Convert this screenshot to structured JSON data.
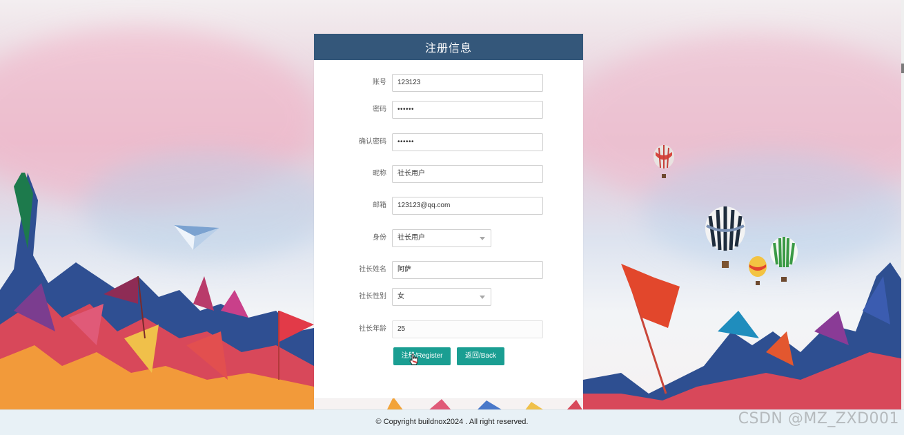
{
  "form": {
    "title": "注册信息",
    "fields": {
      "account": {
        "label": "账号",
        "value": "123123"
      },
      "password": {
        "label": "密码",
        "value": "••••••"
      },
      "confirm_password": {
        "label": "确认密码",
        "value": "••••••"
      },
      "nickname": {
        "label": "昵称",
        "value": "社长用户"
      },
      "email": {
        "label": "邮箱",
        "value": "123123@qq.com"
      },
      "role": {
        "label": "身份",
        "value": "社长用户"
      },
      "president_name": {
        "label": "社长姓名",
        "value": "阿萨"
      },
      "president_gender": {
        "label": "社长性别",
        "value": "女"
      },
      "president_age": {
        "label": "社长年龄",
        "value": "25"
      }
    },
    "buttons": {
      "register": "注册/Register",
      "back": "返回/Back"
    }
  },
  "footer": {
    "copyright": "© Copyright buildnox2024 . All right reserved."
  },
  "watermark": "CSDN @MZ_ZXD001",
  "colors": {
    "header": "#34577a",
    "button": "#1a9e92",
    "footer": "#e8f1f6"
  },
  "icons": [
    "paper-plane-icon",
    "hot-air-balloon-icon",
    "flag-icon",
    "hand-cursor-icon",
    "chevron-down-icon"
  ]
}
